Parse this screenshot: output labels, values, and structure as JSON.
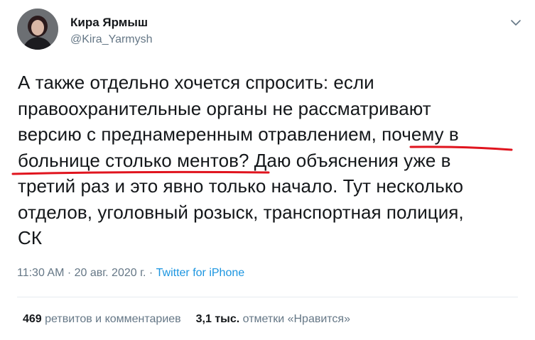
{
  "author": {
    "display_name": "Кира Ярмыш",
    "handle": "@Kira_Yarmysh"
  },
  "tweet": {
    "lines": [
      "А также отдельно хочется спросить: если",
      "правоохранительные органы не рассматривают",
      "версию с преднамеренным отравлением, почему в",
      "больнице столько ментов? Даю объяснения уже в",
      "третий раз и это явно только начало. Тут несколько",
      "отделов, уголовный розыск, транспортная полиция,",
      "СК"
    ]
  },
  "meta": {
    "time": "11:30 AM",
    "separator": " · ",
    "date": "20 авг. 2020 г.",
    "source": "Twitter for iPhone"
  },
  "stats": {
    "retweets_count": "469",
    "retweets_label": "ретвитов и комментариев",
    "likes_count": "3,1 тыс.",
    "likes_label": "отметки «Нравится»"
  },
  "colors": {
    "text": "#14171a",
    "secondary": "#657786",
    "link": "#1b95e0",
    "annotation_underline": "#e0141e"
  },
  "icons": {
    "menu": "chevron-down-icon"
  }
}
